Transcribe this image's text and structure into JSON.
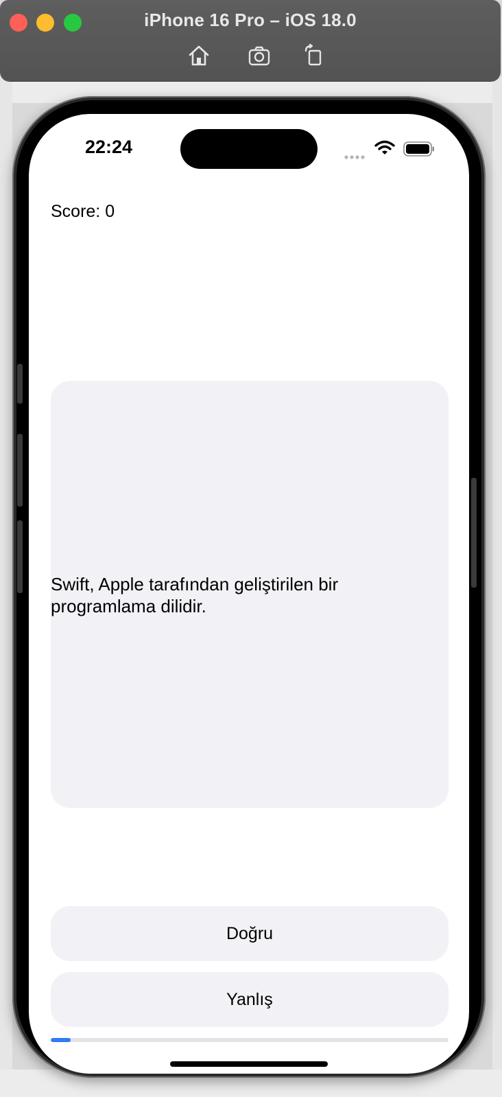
{
  "simulator": {
    "title": "iPhone 16 Pro – iOS 18.0",
    "toolbar": [
      "home-icon",
      "screenshot-icon",
      "rotate-icon"
    ]
  },
  "status_bar": {
    "time": "22:24"
  },
  "quiz": {
    "score_text": "Score: 0",
    "question": "Swift, Apple tarafından geliştirilen bir programlama dilidir.",
    "true_button": "Doğru",
    "false_button": "Yanlış",
    "progress": 0.05
  },
  "colors": {
    "accent": "#2f7cf6",
    "card": "#f1f1f6"
  }
}
